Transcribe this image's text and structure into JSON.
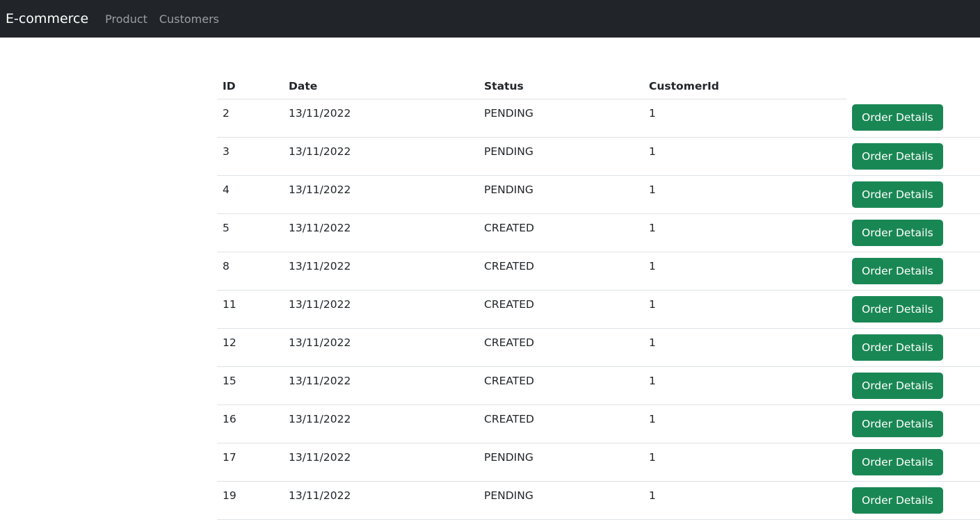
{
  "navbar": {
    "brand": "E-commerce",
    "links": [
      "Product",
      "Customers"
    ]
  },
  "table": {
    "headers": [
      "ID",
      "Date",
      "Status",
      "CustomerId"
    ],
    "action_label": "Order Details",
    "rows": [
      {
        "id": "2",
        "date": "13/11/2022",
        "status": "PENDING",
        "customer_id": "1"
      },
      {
        "id": "3",
        "date": "13/11/2022",
        "status": "PENDING",
        "customer_id": "1"
      },
      {
        "id": "4",
        "date": "13/11/2022",
        "status": "PENDING",
        "customer_id": "1"
      },
      {
        "id": "5",
        "date": "13/11/2022",
        "status": "CREATED",
        "customer_id": "1"
      },
      {
        "id": "8",
        "date": "13/11/2022",
        "status": "CREATED",
        "customer_id": "1"
      },
      {
        "id": "11",
        "date": "13/11/2022",
        "status": "CREATED",
        "customer_id": "1"
      },
      {
        "id": "12",
        "date": "13/11/2022",
        "status": "CREATED",
        "customer_id": "1"
      },
      {
        "id": "15",
        "date": "13/11/2022",
        "status": "CREATED",
        "customer_id": "1"
      },
      {
        "id": "16",
        "date": "13/11/2022",
        "status": "CREATED",
        "customer_id": "1"
      },
      {
        "id": "17",
        "date": "13/11/2022",
        "status": "PENDING",
        "customer_id": "1"
      },
      {
        "id": "19",
        "date": "13/11/2022",
        "status": "PENDING",
        "customer_id": "1"
      }
    ]
  },
  "colors": {
    "navbar_bg": "#212529",
    "button_bg": "#198754"
  }
}
